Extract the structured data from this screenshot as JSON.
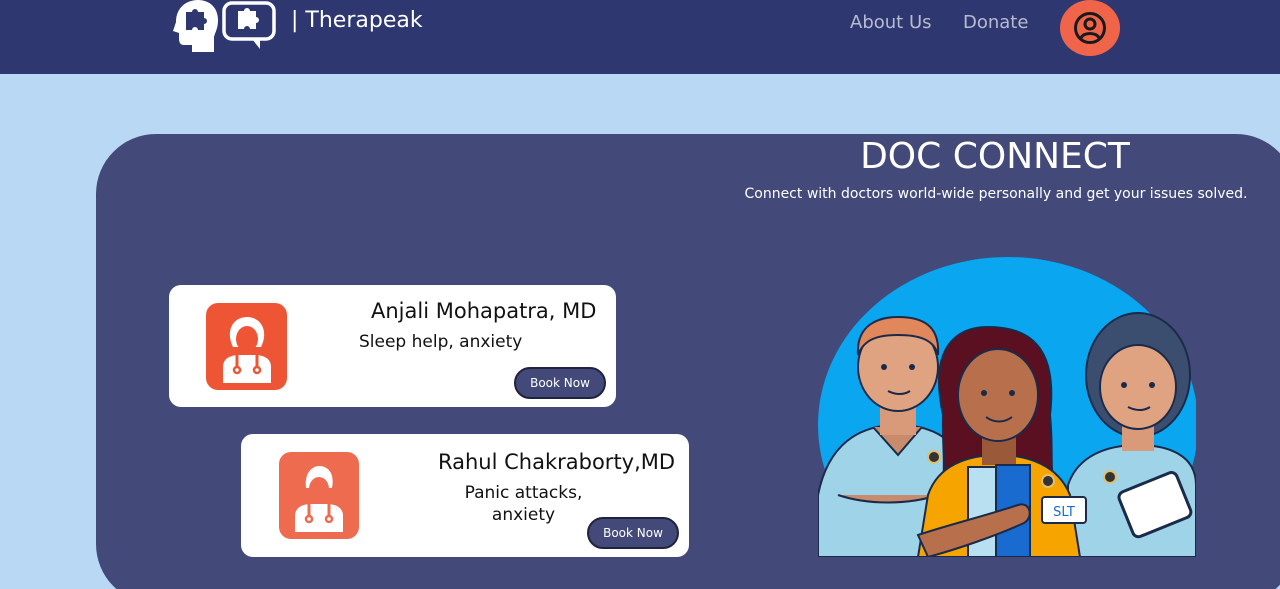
{
  "nav": {
    "brand": "| Therapeak",
    "links": [
      {
        "label": "About Us"
      },
      {
        "label": "Donate"
      }
    ],
    "icons": {
      "logo": "head-puzzle-icon",
      "logo_bubble": "speech-bubble-puzzle-icon",
      "profile": "user-circle-icon"
    }
  },
  "hero": {
    "title": "DOC CONNECT",
    "subtitle": "Connect with doctors world-wide personally and get your issues solved."
  },
  "doctors": [
    {
      "name": "Anjali Mohapatra, MD",
      "specialty": "Sleep help, anxiety",
      "action": "Book Now",
      "icon": "female-doctor-icon"
    },
    {
      "name": "Rahul Chakraborty,MD",
      "specialty": "Panic attacks, anxiety",
      "action": "Book Now",
      "icon": "male-doctor-icon"
    }
  ],
  "illustration": {
    "badge": "SLT"
  },
  "colors": {
    "navbar": "#2e3770",
    "background": "#b9d8f4",
    "panel": "#434a7a",
    "accent": "#ee5535",
    "illustration_bg": "#0aa6f0"
  }
}
